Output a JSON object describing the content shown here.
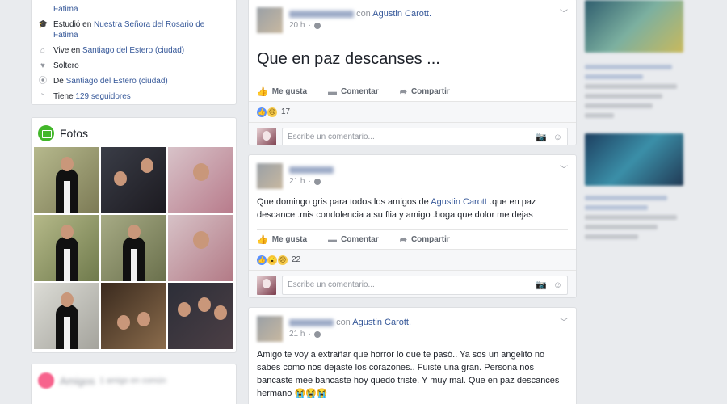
{
  "about": {
    "rows": [
      {
        "icon": "school-icon",
        "prefix": "",
        "link": "Fatima"
      },
      {
        "icon": "school-icon",
        "prefix": "Estudió en ",
        "link": "Nuestra Señora del Rosario de Fatima"
      },
      {
        "icon": "home-icon",
        "prefix": "Vive en ",
        "link": "Santiago del Estero (ciudad)"
      },
      {
        "icon": "heart-icon",
        "prefix": "Soltero",
        "link": ""
      },
      {
        "icon": "location-pin-icon",
        "prefix": "De ",
        "link": "Santiago del Estero (ciudad)"
      },
      {
        "icon": "rss-icon",
        "prefix": "Tiene ",
        "link": "129 seguidores"
      }
    ]
  },
  "photos": {
    "title": "Fotos",
    "count": 9
  },
  "friends": {
    "title": "Amigos",
    "subtitle": "1 amigo en común"
  },
  "posts": [
    {
      "with_word": "con",
      "tagged": "Agustin Carott.",
      "time": "20 h",
      "content_big": "Que en paz descanses ...",
      "reaction_count": "17"
    },
    {
      "time": "21 h",
      "text_before": "Que domingo gris para todos los amigos de ",
      "tag": "Agustin Carott",
      "text_after": " .que en paz descance .mis condolencia a su flia y amigo .boga que dolor me dejas",
      "reaction_count": "22"
    },
    {
      "with_word": "con",
      "tagged": "Agustin Carott.",
      "time": "21 h",
      "text": "Amigo te voy a extrañar que horror lo que te pasó.. Ya sos un angelito no sabes como nos dejaste los corazones.. Fuiste una gran. Persona nos bancaste mee bancaste hoy quedo triste. Y muy mal. Que en paz descances hermano 😭😭😭"
    }
  ],
  "actions": {
    "like": "Me gusta",
    "comment": "Comentar",
    "share": "Compartir"
  },
  "comment_placeholder": "Escribe un comentario...",
  "colors": {
    "link": "#365899",
    "background": "#e9ebee",
    "like_blue": "#5890ff",
    "photos_green": "#42b72a"
  }
}
